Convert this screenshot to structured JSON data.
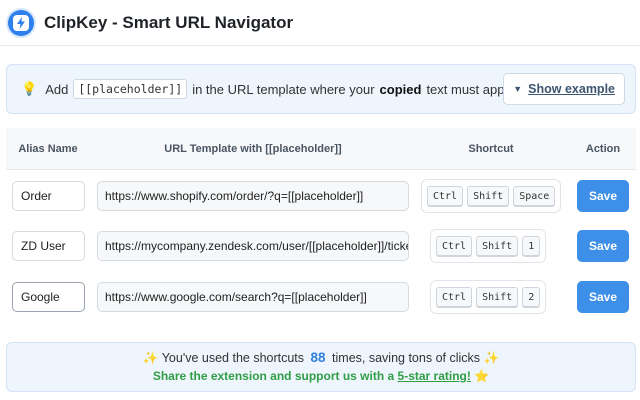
{
  "header": {
    "title": "ClipKey - Smart URL Navigator",
    "logo_icon": "lightning-icon",
    "accent": "#2f80ed"
  },
  "tip": {
    "icon": "lightbulb-icon",
    "pre": "Add",
    "code": "[[placeholder]]",
    "mid": "in the URL template where your",
    "bold": "copied",
    "post": "text must appear",
    "show_example": "Show example"
  },
  "table": {
    "headers": [
      "Alias Name",
      "URL Template with [[placeholder]]",
      "Shortcut",
      "Action"
    ],
    "rows": [
      {
        "alias": "Order",
        "url": "https://www.shopify.com/order/?q=[[placeholder]]",
        "keys": [
          "Ctrl",
          "Shift",
          "Space"
        ],
        "action": "Save"
      },
      {
        "alias": "ZD User",
        "url": "https://mycompany.zendesk.com/user/[[placeholder]]/ticket",
        "keys": [
          "Ctrl",
          "Shift",
          "1"
        ],
        "action": "Save"
      },
      {
        "alias": "Google",
        "url": "https://www.google.com/search?q=[[placeholder]]",
        "keys": [
          "Ctrl",
          "Shift",
          "2"
        ],
        "action": "Save"
      }
    ]
  },
  "footer": {
    "line1_pre": "You've used the shortcuts",
    "count": "88",
    "line1_post": "times, saving tons of clicks",
    "line2_pre": "Share the extension and support us with a",
    "link": "5-star rating!"
  },
  "colors": {
    "save_button": "#3d8fe8",
    "footer_green": "#2f9e44",
    "count_blue": "#2f7fd8"
  }
}
